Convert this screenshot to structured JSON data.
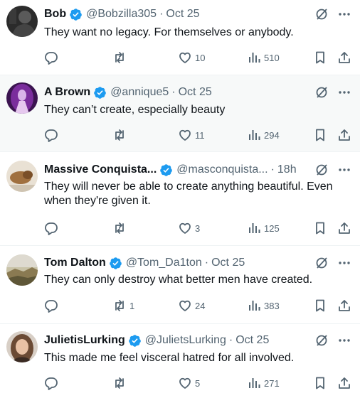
{
  "replies": [
    {
      "name": "Bob",
      "handle": "@Bobzilla305",
      "time": "Oct 25",
      "text": "They want no legacy. For themselves or anybody.",
      "reply_count": "",
      "repost_count": "",
      "like_count": "10",
      "view_count": "510",
      "avatar_icon": "dark-portrait-avatar"
    },
    {
      "name": "A Brown",
      "handle": "@annique5",
      "time": "Oct 25",
      "text": "They can’t create, especially beauty",
      "reply_count": "",
      "repost_count": "",
      "like_count": "11",
      "view_count": "294",
      "avatar_icon": "purple-figure-avatar"
    },
    {
      "name": "Massive Conquista...",
      "handle": "@masconquista...",
      "time": "18h",
      "text": "They will never be able to create anything beautiful. Even when they're given it.",
      "reply_count": "",
      "repost_count": "",
      "like_count": "3",
      "view_count": "125",
      "avatar_icon": "beige-animal-avatar"
    },
    {
      "name": "Tom Dalton",
      "handle": "@Tom_Da1ton",
      "time": "Oct 25",
      "text": "They can only destroy what better men have created.",
      "reply_count": "",
      "repost_count": "1",
      "like_count": "24",
      "view_count": "383",
      "avatar_icon": "landscape-avatar"
    },
    {
      "name": "JulietisLurking",
      "handle": "@JulietsLurking",
      "time": "Oct 25",
      "text": "This made me feel visceral hatred for all involved.",
      "reply_count": "",
      "repost_count": "",
      "like_count": "5",
      "view_count": "271",
      "avatar_icon": "woman-portrait-avatar"
    }
  ],
  "separator": "·",
  "colors": {
    "verified_blue": "#1d9bf0",
    "text_primary": "#0f1419",
    "text_secondary": "#536471",
    "divider": "#eff3f4",
    "highlight_bg": "#f7f9f9"
  }
}
